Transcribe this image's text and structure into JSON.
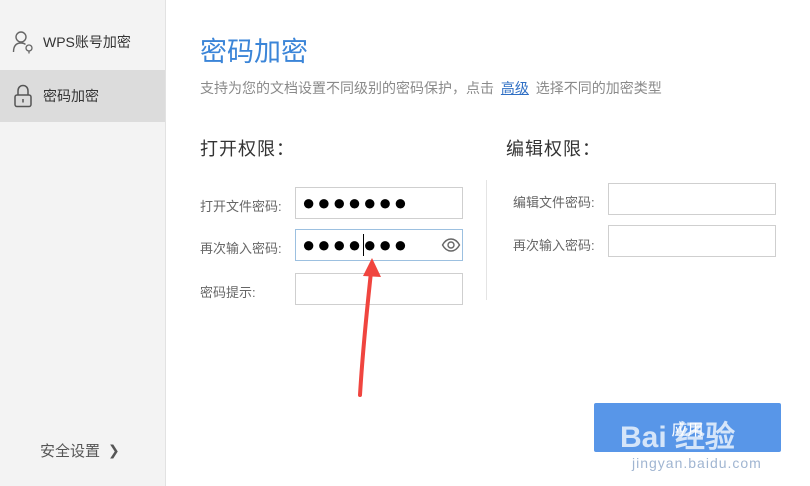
{
  "sidebar": {
    "items": [
      {
        "label": "WPS账号加密",
        "icon": "user-lock-icon",
        "active": false
      },
      {
        "label": "密码加密",
        "icon": "padlock-icon",
        "active": true
      }
    ],
    "security_settings": "安全设置",
    "security_chevron": "❯"
  },
  "main": {
    "title": "密码加密",
    "subtitle_before": "支持为您的文档设置不同级别的密码保护，点击",
    "subtitle_link": "高级",
    "subtitle_after": "选择不同的加密类型",
    "open_section": {
      "title": "打开权限：",
      "password_label": "打开文件密码:",
      "password_value": "●●●●●●●",
      "confirm_label": "再次输入密码:",
      "confirm_value": "●●●●●●●",
      "hint_label": "密码提示:",
      "hint_value": ""
    },
    "edit_section": {
      "title": "编辑权限：",
      "password_label": "编辑文件密码:",
      "password_value": "",
      "confirm_label": "再次输入密码:",
      "confirm_value": ""
    },
    "apply_label": "应用"
  },
  "watermark": {
    "text": "Bai 经验",
    "url": "jingyan.baidu.com"
  },
  "colors": {
    "accent": "#3b85d8",
    "button": "#5896e8",
    "annotation_arrow": "#f0453f"
  }
}
